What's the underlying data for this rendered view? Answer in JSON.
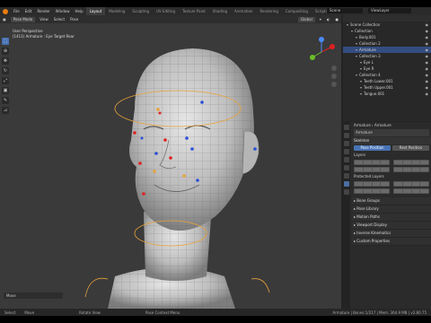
{
  "topbar": {
    "menus": [
      "File",
      "Edit",
      "Render",
      "Window",
      "Help"
    ],
    "workspaces": [
      "Layout",
      "Modeling",
      "Sculpting",
      "UV Editing",
      "Texture Paint",
      "Shading",
      "Animation",
      "Rendering",
      "Compositing",
      "Scripting"
    ],
    "active_workspace": "Layout",
    "scene": "Scene",
    "view_layer": "ViewLayer"
  },
  "viewport_header": {
    "mode": "Pose Mode",
    "menus": [
      "View",
      "Select",
      "Pose"
    ],
    "orientation": "Global"
  },
  "viewport_info": {
    "line1": "User Perspective",
    "line2": "(1411) Armature : Eye Target Rear"
  },
  "last_op": "Move",
  "outliner": {
    "rows": [
      {
        "label": "Scene Collection",
        "indent": 0
      },
      {
        "label": "Collection",
        "indent": 1
      },
      {
        "label": "Body.001",
        "indent": 2
      },
      {
        "label": "Collection 2",
        "indent": 2
      },
      {
        "label": "Armature",
        "indent": 2,
        "selected": true
      },
      {
        "label": "Collection 3",
        "indent": 2
      },
      {
        "label": "Eye L",
        "indent": 3
      },
      {
        "label": "Eye R",
        "indent": 3
      },
      {
        "label": "Collection 4",
        "indent": 2
      },
      {
        "label": "Teeth Lower.001",
        "indent": 3
      },
      {
        "label": "Teeth Upper.001",
        "indent": 3
      },
      {
        "label": "Tongue.001",
        "indent": 3
      }
    ]
  },
  "properties": {
    "breadcrumb": [
      "Armature",
      "Armature"
    ],
    "data_name": "Armature",
    "skeleton_label": "Skeleton",
    "pose_position": "Pose Position",
    "rest_position": "Rest Position",
    "layers_label": "Layers",
    "protected_label": "Protected Layers",
    "panels": [
      "Bone Groups",
      "Pose Library",
      "Motion Paths",
      "Viewport Display",
      "Inverse Kinematics",
      "Custom Properties"
    ]
  },
  "statusbar": {
    "select": "Select",
    "move": "Move",
    "rotate": "Rotate View",
    "context": "Pose Context Menu",
    "stats": "Armature | Bones:1/217 | Mem: 364.9 MB | v2.80.75"
  },
  "colors": {
    "accent": "#4772b3",
    "selection_outline": "#e8a23a",
    "bone_blue": "#2a4fd8",
    "bone_red": "#e02020"
  }
}
